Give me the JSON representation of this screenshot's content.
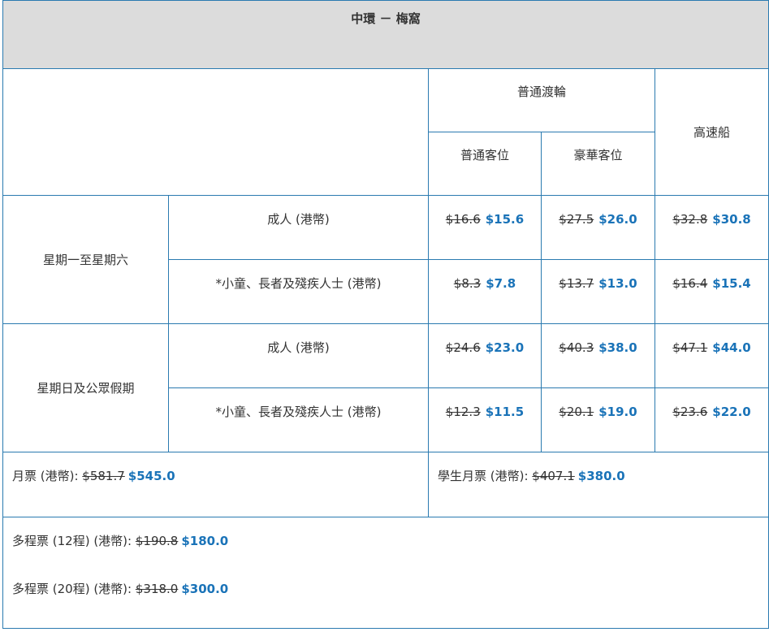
{
  "title": "中環 － 梅窩",
  "headers": {
    "ordinary_ferry": "普通渡輪",
    "fast_ferry": "高速船",
    "ordinary_class": "普通客位",
    "deluxe_class": "豪華客位"
  },
  "groups": [
    {
      "label": "星期一至星期六",
      "rows": [
        {
          "ticket": "成人 (港幣)",
          "prices": [
            {
              "old": "$16.6",
              "new": "$15.6"
            },
            {
              "old": "$27.5",
              "new": "$26.0"
            },
            {
              "old": "$32.8",
              "new": "$30.8"
            }
          ]
        },
        {
          "ticket": "*小童、長者及殘疾人士 (港幣)",
          "prices": [
            {
              "old": "$8.3",
              "new": "$7.8"
            },
            {
              "old": "$13.7",
              "new": "$13.0"
            },
            {
              "old": "$16.4",
              "new": "$15.4"
            }
          ]
        }
      ]
    },
    {
      "label": "星期日及公眾假期",
      "rows": [
        {
          "ticket": "成人 (港幣)",
          "prices": [
            {
              "old": "$24.6",
              "new": "$23.0"
            },
            {
              "old": "$40.3",
              "new": "$38.0"
            },
            {
              "old": "$47.1",
              "new": "$44.0"
            }
          ]
        },
        {
          "ticket": "*小童、長者及殘疾人士 (港幣)",
          "prices": [
            {
              "old": "$12.3",
              "new": "$11.5"
            },
            {
              "old": "$20.1",
              "new": "$19.0"
            },
            {
              "old": "$23.6",
              "new": "$22.0"
            }
          ]
        }
      ]
    }
  ],
  "monthly": {
    "label": "月票 (港幣): ",
    "old": "$581.7",
    "new": "$545.0"
  },
  "student_monthly": {
    "label": "學生月票 (港幣): ",
    "old": "$407.1",
    "new": "$380.0"
  },
  "multi_12": {
    "label": "多程票 (12程) (港幣): ",
    "old": "$190.8",
    "new": "$180.0"
  },
  "multi_20": {
    "label": "多程票 (20程) (港幣): ",
    "old": "$318.0",
    "new": "$300.0"
  },
  "colors": {
    "border": "#2a7ab0",
    "new_price": "#1a73b8",
    "title_bg": "#dcdcdc"
  }
}
